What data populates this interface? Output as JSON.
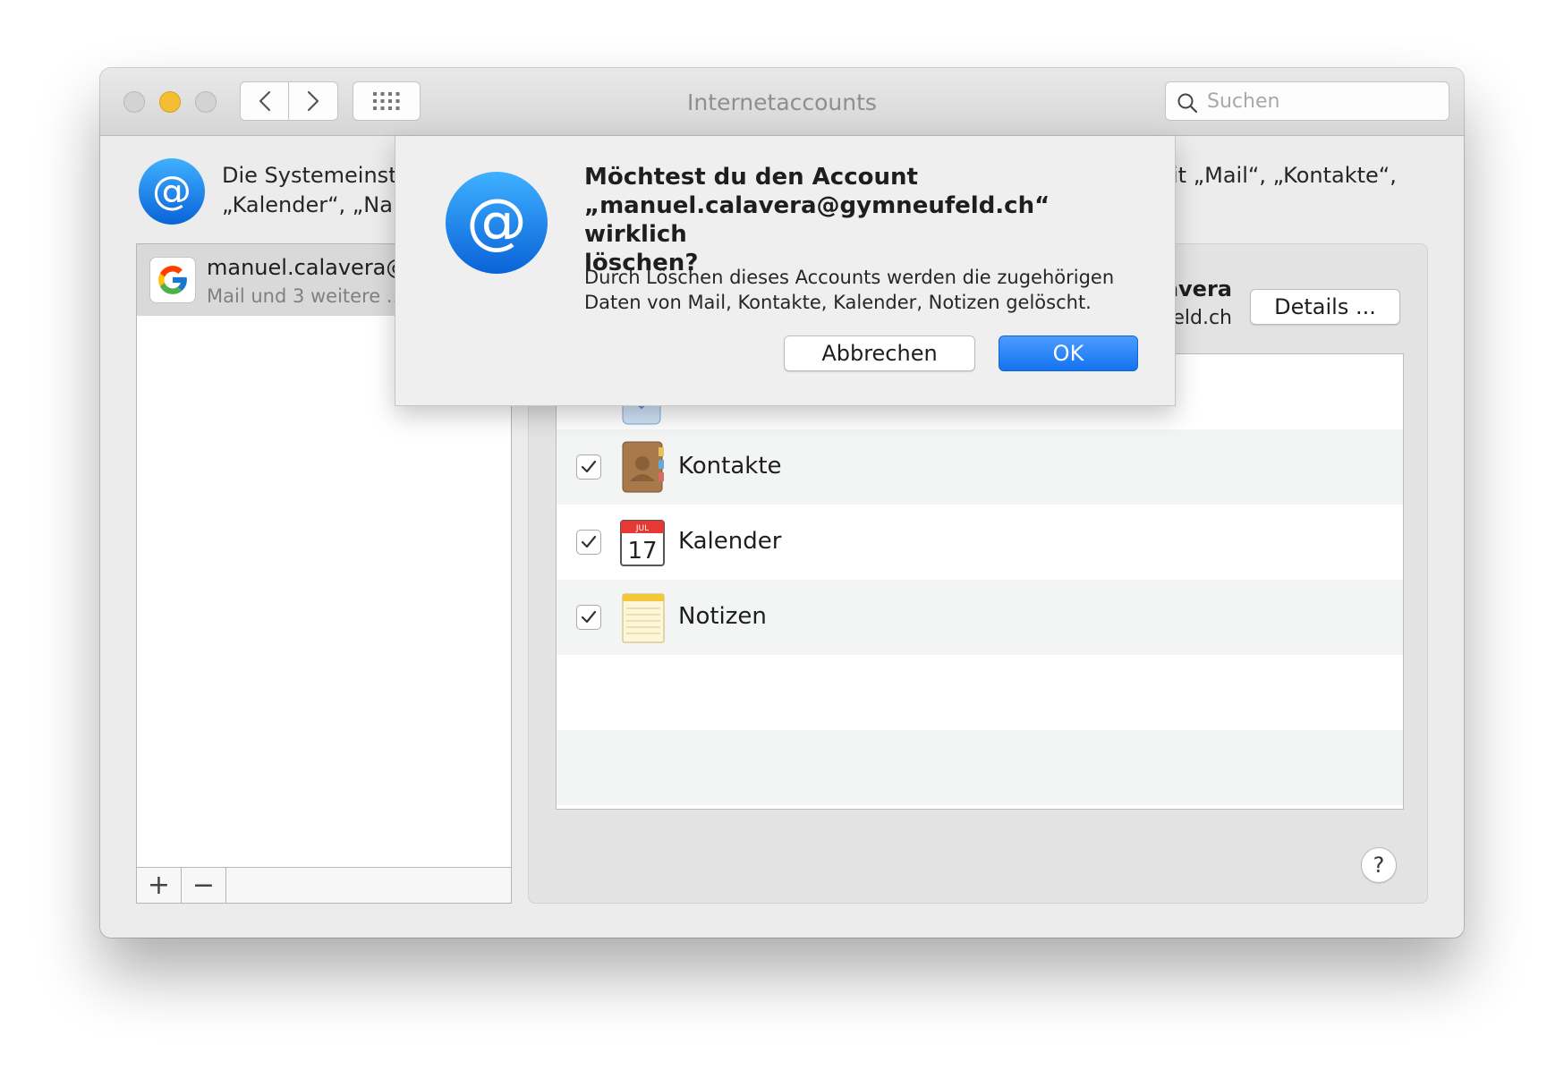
{
  "window": {
    "title": "Internetaccounts",
    "search_placeholder": "Suchen"
  },
  "intro": {
    "line1_left": "Die Systemeinst",
    "line1_right": "it „Mail“, „Kontakte“,",
    "line2_left": "„Kalender“, „Na"
  },
  "accounts": [
    {
      "name": "manuel.calavera@",
      "subtitle": "Mail und 3 weitere ..."
    }
  ],
  "toolbar": {
    "add_label": "+",
    "remove_label": "−"
  },
  "detail": {
    "name_visible": "avera",
    "email_visible": "feld.ch",
    "details_button": "Details ..."
  },
  "services": [
    {
      "label": "Kontakte",
      "checked": true,
      "icon": "contacts-icon"
    },
    {
      "label": "Kalender",
      "checked": true,
      "icon": "calendar-icon"
    },
    {
      "label": "Notizen",
      "checked": true,
      "icon": "notes-icon"
    }
  ],
  "calendar_icon": {
    "month": "JUL",
    "day": "17"
  },
  "help_label": "?",
  "alert": {
    "title_line1": "Möchtest du den Account",
    "title_line2": "„manuel.calavera@gymneufeld.ch“ wirklich",
    "title_line3": "löschen?",
    "message_line1": "Durch Löschen dieses Accounts werden die zugehörigen",
    "message_line2": "Daten von Mail, Kontakte, Kalender, Notizen gelöscht.",
    "cancel_button": "Abbrechen",
    "ok_button": "OK"
  },
  "colors": {
    "accent": "#1473f0",
    "minimize": "#f5bd32",
    "at_icon": "#1a86f0"
  }
}
